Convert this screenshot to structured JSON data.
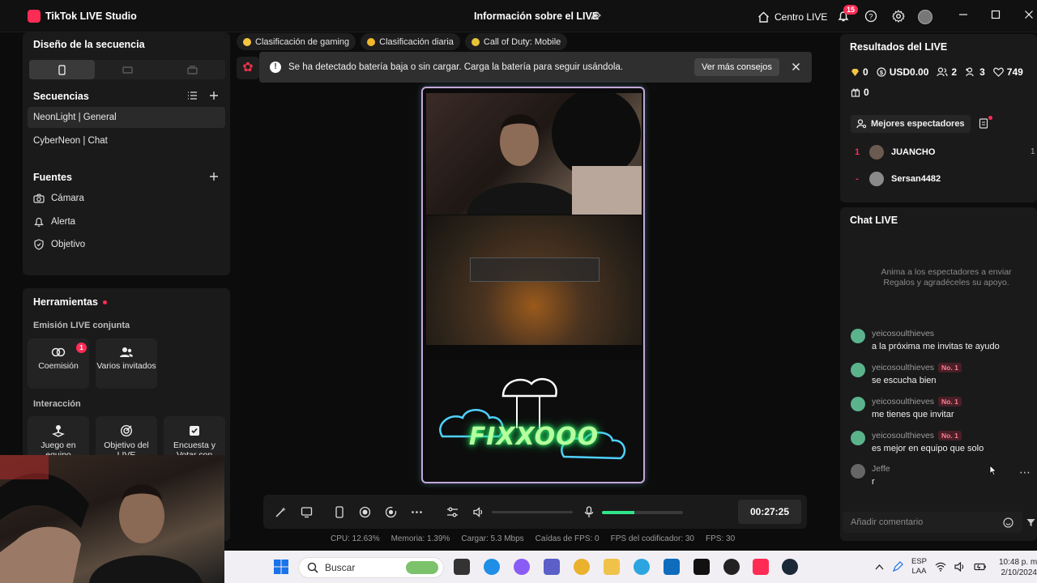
{
  "titlebar": {
    "app_name": "TikTok LIVE Studio",
    "window_title": "Información sobre el LIVE",
    "centro_live": "Centro LIVE",
    "notifications_count": "15"
  },
  "left": {
    "layout_title": "Diseño de la secuencia",
    "sequences_title": "Secuencias",
    "sequences": [
      "NeonLight | General",
      "CyberNeon | Chat"
    ],
    "sources_title": "Fuentes",
    "sources": [
      "Cámara",
      "Alerta",
      "Objetivo"
    ],
    "tools_title": "Herramientas",
    "emision_title": "Emisión LIVE conjunta",
    "coemision": "Coemisión",
    "coemision_badge": "1",
    "varios_invitados": "Varios invitados",
    "interaccion_title": "Interacción",
    "juego": "Juego en equipo",
    "objetivo": "Objetivo del LIVE",
    "encuesta": "Encuesta y Votar con"
  },
  "center": {
    "tags": [
      "Clasificación de gaming",
      "Clasificación diaria",
      "Call of Duty: Mobile"
    ],
    "toast_text": "Se ha detectado batería baja o sin cargar. Carga la batería para seguir usándola.",
    "toast_button": "Ver más consejos",
    "overlay_logo_text": "FIXXOOO",
    "timer": "00:27:25",
    "mic_level": 0.4
  },
  "stats": {
    "cpu": "CPU: 12.63%",
    "memory": "Memoria: 1.39%",
    "upload": "Cargar: 5.3 Mbps",
    "fps_drops": "Caídas de FPS: 0",
    "encoder_fps": "FPS del codificador: 30",
    "fps": "FPS: 30"
  },
  "right": {
    "results_title": "Resultados del LIVE",
    "diamonds": "0",
    "usd": "USD0.00",
    "viewers": "2",
    "followers": "3",
    "likes": "749",
    "gifts": "0",
    "top_viewers_button": "Mejores espectadores",
    "top_viewers": [
      {
        "rank": "1",
        "name": "JUANCHO",
        "score": "1"
      },
      {
        "rank": "-",
        "name": "Sersan4482",
        "score": ""
      }
    ],
    "chat_title": "Chat LIVE",
    "chat_empty": "Anima a los espectadores a enviar Regalos y agradéceles su apoyo.",
    "messages": [
      {
        "user": "yeicosoulthieves",
        "badge": "",
        "text": "a la próxima me invitas te ayudo"
      },
      {
        "user": "yeicosoulthieves",
        "badge": "No. 1",
        "text": "se escucha bien"
      },
      {
        "user": "yeicosoulthieves",
        "badge": "No. 1",
        "text": "me tienes que invitar"
      },
      {
        "user": "yeicosoulthieves",
        "badge": "No. 1",
        "text": "es mejor en equipo que solo"
      },
      {
        "user": "Jeffe",
        "badge": "",
        "text": "r"
      }
    ],
    "comment_placeholder": "Añadir comentario"
  },
  "taskbar": {
    "search": "Buscar",
    "lang_1": "ESP",
    "lang_2": "LAA",
    "time": "10:48 p. m.",
    "date": "2/10/2024"
  }
}
